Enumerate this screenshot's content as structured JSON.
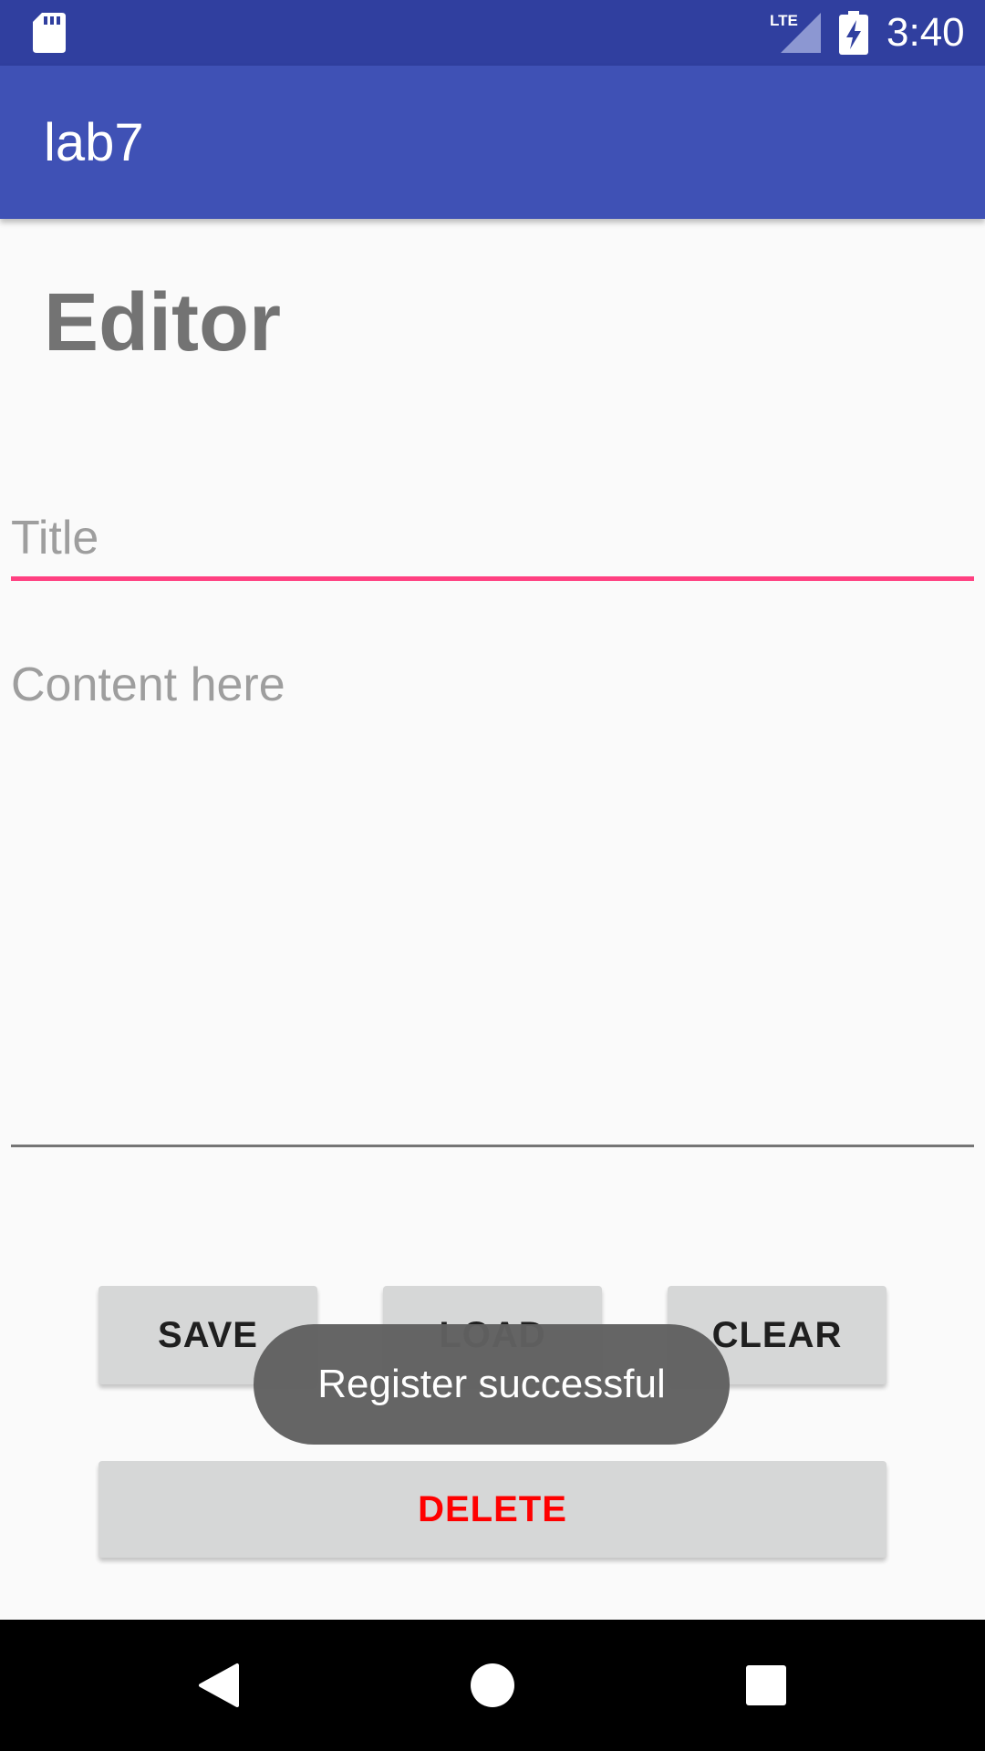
{
  "status_bar": {
    "time": "3:40",
    "network_label": "LTE",
    "icons": [
      "sd-card-icon",
      "lte-signal-icon",
      "battery-charging-icon"
    ]
  },
  "app_bar": {
    "title": "lab7"
  },
  "editor": {
    "heading": "Editor",
    "title_field": {
      "value": "",
      "placeholder": "Title"
    },
    "content_field": {
      "value": "",
      "placeholder": "Content here"
    }
  },
  "buttons": {
    "save": "SAVE",
    "load": "LOAD",
    "clear": "CLEAR",
    "delete": "DELETE"
  },
  "toast": {
    "message": "Register successful"
  },
  "nav_bar": {
    "icons": [
      "back-icon",
      "home-icon",
      "recents-icon"
    ]
  },
  "colors": {
    "status_bar": "#303f9f",
    "app_bar": "#3f51b5",
    "accent": "#ff4081",
    "delete_text": "#ff0000",
    "button_bg": "#d6d7d7",
    "background": "#fafafa"
  }
}
